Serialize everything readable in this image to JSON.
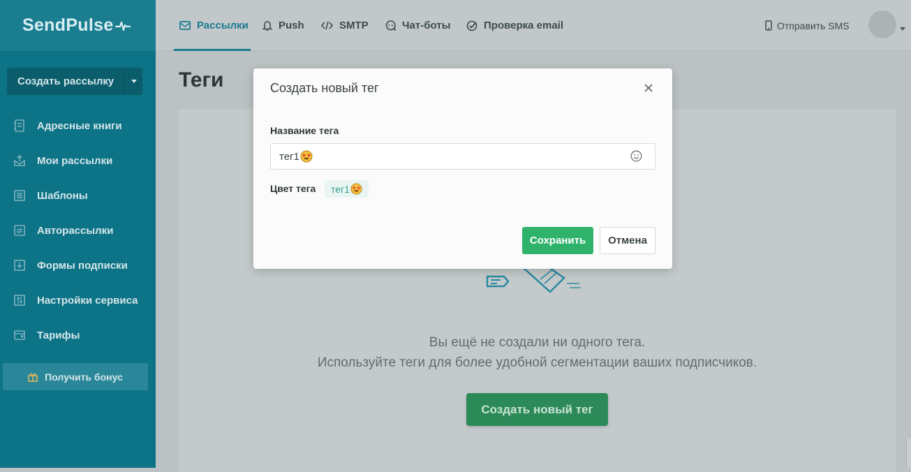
{
  "brand": {
    "name": "SendPulse"
  },
  "sidebar": {
    "create_label": "Создать рассылку",
    "items": [
      {
        "label": "Адресные книги",
        "icon": "address-book-icon"
      },
      {
        "label": "Мои рассылки",
        "icon": "mailings-icon"
      },
      {
        "label": "Шаблоны",
        "icon": "templates-icon"
      },
      {
        "label": "Авторассылки",
        "icon": "automation-icon"
      },
      {
        "label": "Формы подписки",
        "icon": "forms-icon"
      },
      {
        "label": "Настройки сервиса",
        "icon": "settings-sliders-icon"
      },
      {
        "label": "Тарифы",
        "icon": "wallet-icon"
      }
    ],
    "bonus_label": "Получить бонус"
  },
  "topnav": {
    "tabs": [
      {
        "label": "Рассылки",
        "icon": "envelope-icon",
        "active": true
      },
      {
        "label": "Push",
        "icon": "bell-icon"
      },
      {
        "label": "SMTP",
        "icon": "code-icon"
      },
      {
        "label": "Чат-боты",
        "icon": "chat-bot-icon"
      },
      {
        "label": "Проверка email",
        "icon": "check-circle-icon"
      }
    ],
    "sms_label": "Отправить SMS"
  },
  "page": {
    "title": "Теги",
    "empty_line1": "Вы ещё не создали ни одного тега.",
    "empty_line2": "Используйте теги для более удобной сегментации ваших подписчиков.",
    "create_tag_button": "Создать новый тег"
  },
  "modal": {
    "title": "Создать новый тег",
    "name_label": "Название тега",
    "name_value": "тег1",
    "color_label": "Цвет тега",
    "tag_preview": "тег1",
    "tag_color": "#3aa191",
    "save_label": "Сохранить",
    "cancel_label": "Отмена"
  },
  "colors": {
    "sidebar": "#0d7386",
    "accent": "#1a7a90",
    "primary_green": "#2fb36b"
  }
}
